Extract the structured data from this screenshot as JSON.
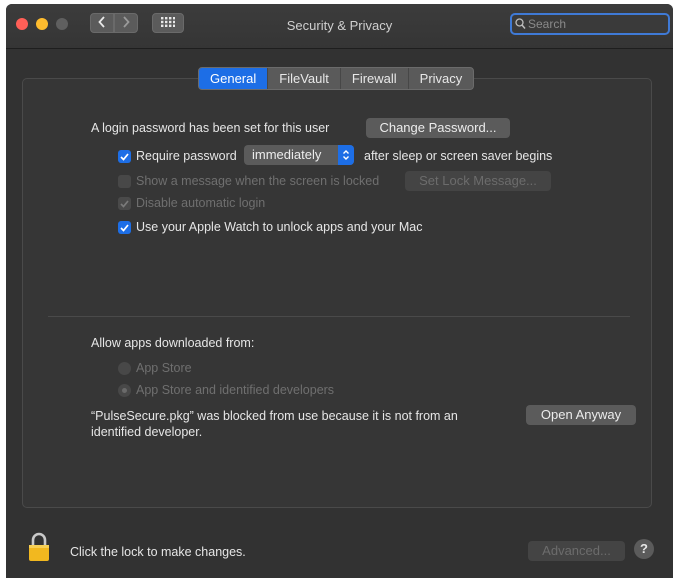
{
  "window": {
    "title": "Security & Privacy",
    "search_placeholder": "Search"
  },
  "tabs": [
    {
      "label": "General",
      "active": true
    },
    {
      "label": "FileVault",
      "active": false
    },
    {
      "label": "Firewall",
      "active": false
    },
    {
      "label": "Privacy",
      "active": false
    }
  ],
  "general": {
    "login_text": "A login password has been set for this user",
    "change_password_button": "Change Password...",
    "require_password": {
      "label": "Require password",
      "checked": true
    },
    "require_select_value": "immediately",
    "require_suffix": "after sleep or screen saver begins",
    "show_message": {
      "label": "Show a message when the screen is locked",
      "checked": false,
      "enabled": false
    },
    "set_lock_message_button": "Set Lock Message...",
    "disable_auto_login": {
      "label": "Disable automatic login",
      "checked": true,
      "enabled": false
    },
    "apple_watch": {
      "label": "Use your Apple Watch to unlock apps and your Mac",
      "checked": true
    }
  },
  "downloads": {
    "heading": "Allow apps downloaded from:",
    "options": [
      {
        "label": "App Store",
        "selected": false
      },
      {
        "label": "App Store and identified developers",
        "selected": true
      }
    ],
    "blocked_line1": "“PulseSecure.pkg” was blocked from use because it is not from an",
    "blocked_line2": "identified developer.",
    "open_anyway_button": "Open Anyway"
  },
  "footer": {
    "lock_text": "Click the lock to make changes.",
    "advanced_button": "Advanced...",
    "help_label": "?"
  },
  "colors": {
    "accent": "#1d6ee6",
    "window_bg": "#323232"
  },
  "icons": {
    "lock": "lock-icon",
    "search": "search-icon",
    "grid": "grid-icon"
  }
}
